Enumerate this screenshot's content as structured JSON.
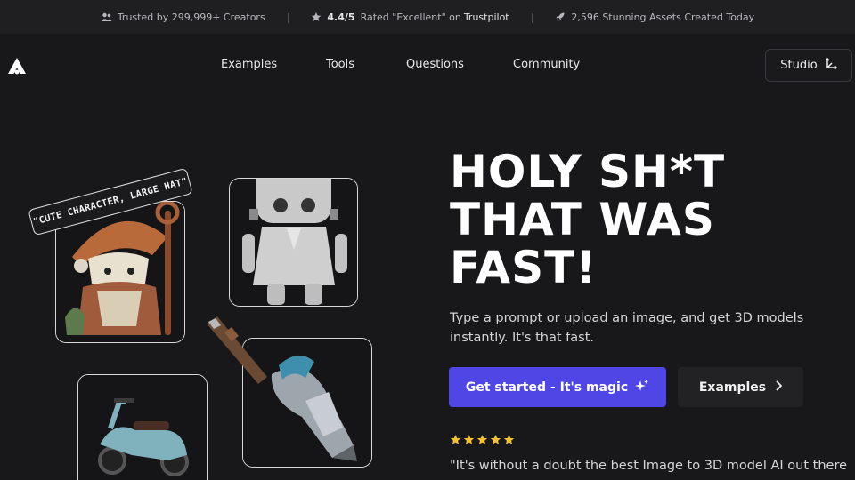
{
  "topbar": {
    "trusted": "Trusted by 299,999+ Creators",
    "rating_value": "4.4/5",
    "rating_text": "Rated \"Excellent\" on",
    "rating_brand": "Trustpilot",
    "assets": "2,596 Stunning Assets Created Today",
    "separator": "|"
  },
  "nav": {
    "links": [
      "Examples",
      "Tools",
      "Questions",
      "Community"
    ],
    "studio_label": "Studio"
  },
  "hero": {
    "title_lines": [
      "HOLY SH*T",
      "THAT WAS",
      "FAST!"
    ],
    "subtitle": "Type a prompt or upload an image, and get 3D models instantly. It's that fast.",
    "cta_label": "Get started - It's magic",
    "examples_label": "Examples",
    "rating_stars": 5,
    "quote": "\"It's without a doubt the best Image to 3D model AI out there"
  },
  "gallery": {
    "prompt_tag": "\"CUTE CHARACTER, LARGE HAT\""
  },
  "colors": {
    "background": "#18181a",
    "accent": "#4f46e5",
    "star": "#f4c430"
  }
}
